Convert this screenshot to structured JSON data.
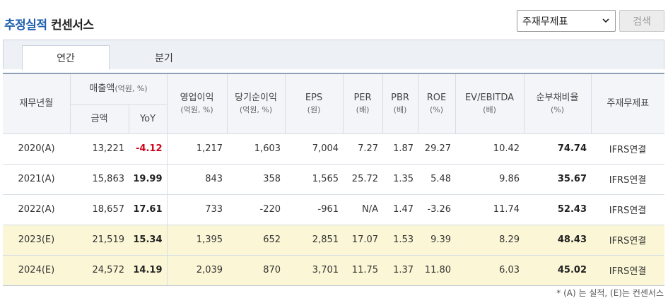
{
  "header": {
    "title_accent": "추정실적",
    "title_rest": " 컨센서스",
    "filter_select_value": "주재무제표",
    "search_button_label": "검색"
  },
  "tabs": [
    {
      "label": "연간",
      "active": true
    },
    {
      "label": "분기",
      "active": false
    }
  ],
  "table": {
    "headers": {
      "year": "재무년월",
      "sales_group": "매출액",
      "sales_group_unit": "(억원, %)",
      "amount": "금액",
      "yoy": "YoY",
      "op_profit": "영업이익",
      "op_profit_unit": "(억원, %)",
      "net_income": "당기순이익",
      "net_income_unit": "(억원, %)",
      "eps": "EPS",
      "eps_unit": "(원)",
      "per": "PER",
      "per_unit": "(배)",
      "pbr": "PBR",
      "pbr_unit": "(배)",
      "roe": "ROE",
      "roe_unit": "(%)",
      "ev_ebitda": "EV/EBITDA",
      "ev_ebitda_unit": "(배)",
      "net_debt_ratio": "순부채비율",
      "net_debt_ratio_unit": "(%)",
      "statement": "주재무제표"
    },
    "rows": [
      {
        "year": "2020(A)",
        "amount": "13,221",
        "yoy": "-4.12",
        "op_profit": "1,217",
        "net_income": "1,603",
        "eps": "7,004",
        "per": "7.27",
        "pbr": "1.87",
        "roe": "29.27",
        "ev_ebitda": "10.42",
        "net_debt_ratio": "74.74",
        "statement": "IFRS연결"
      },
      {
        "year": "2021(A)",
        "amount": "15,863",
        "yoy": "19.99",
        "op_profit": "843",
        "net_income": "358",
        "eps": "1,565",
        "per": "25.72",
        "pbr": "1.35",
        "roe": "5.48",
        "ev_ebitda": "9.86",
        "net_debt_ratio": "35.67",
        "statement": "IFRS연결"
      },
      {
        "year": "2022(A)",
        "amount": "18,657",
        "yoy": "17.61",
        "op_profit": "733",
        "net_income": "-220",
        "eps": "-961",
        "per": "N/A",
        "pbr": "1.47",
        "roe": "-3.26",
        "ev_ebitda": "11.74",
        "net_debt_ratio": "52.43",
        "statement": "IFRS연결"
      },
      {
        "year": "2023(E)",
        "amount": "21,519",
        "yoy": "15.34",
        "op_profit": "1,395",
        "net_income": "652",
        "eps": "2,851",
        "per": "17.07",
        "pbr": "1.53",
        "roe": "9.39",
        "ev_ebitda": "8.29",
        "net_debt_ratio": "48.43",
        "statement": "IFRS연결"
      },
      {
        "year": "2024(E)",
        "amount": "24,572",
        "yoy": "14.19",
        "op_profit": "2,039",
        "net_income": "870",
        "eps": "3,701",
        "per": "11.75",
        "pbr": "1.37",
        "roe": "11.80",
        "ev_ebitda": "6.03",
        "net_debt_ratio": "45.02",
        "statement": "IFRS연결"
      }
    ]
  },
  "footnote": "* (A) 는 실적, (E)는 컨센서스",
  "colors": {
    "accent": "#1f5fae",
    "negative": "#d0021b",
    "estimate_row": "#fbf7d6",
    "header_bg": "#f3f5f8"
  }
}
